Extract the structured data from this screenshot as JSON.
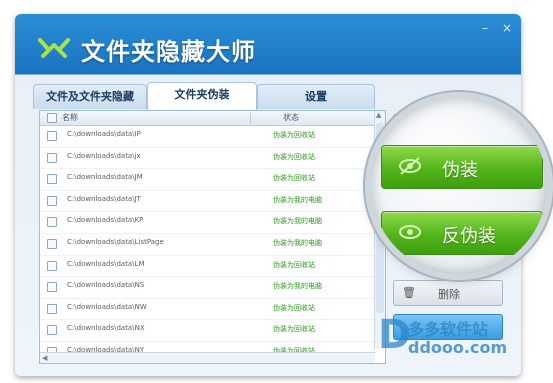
{
  "app": {
    "title": "文件夹隐藏大师"
  },
  "tabs": [
    {
      "label": "文件及文件夹隐藏"
    },
    {
      "label": "文件夹伪装"
    },
    {
      "label": "设置"
    }
  ],
  "list": {
    "columns": {
      "name": "名称",
      "status": "状态"
    },
    "rows": [
      {
        "path": "C:\\downloads\\data\\IP",
        "status": "伪装为回收站"
      },
      {
        "path": "C:\\downloads\\data\\jx",
        "status": "伪装为回收站"
      },
      {
        "path": "C:\\downloads\\data\\JM",
        "status": "伪装为回收站"
      },
      {
        "path": "C:\\downloads\\data\\JT",
        "status": "伪装为我的电脑"
      },
      {
        "path": "C:\\downloads\\data\\KP",
        "status": "伪装为我的电脑"
      },
      {
        "path": "C:\\downloads\\data\\ListPage",
        "status": "伪装为我的电脑"
      },
      {
        "path": "C:\\downloads\\data\\LM",
        "status": "伪装为回收站"
      },
      {
        "path": "C:\\downloads\\data\\NS",
        "status": "伪装为我的电脑"
      },
      {
        "path": "C:\\downloads\\data\\NW",
        "status": "伪装为回收站"
      },
      {
        "path": "C:\\downloads\\data\\NX",
        "status": "伪装为回收站"
      },
      {
        "path": "C:\\downloads\\data\\NY",
        "status": "伪装为回收站"
      }
    ]
  },
  "actions": {
    "disguise": "伪装",
    "undisguise": "反伪装",
    "delete": "删除"
  },
  "watermark": {
    "logo": "D",
    "site_name": "多多软件站",
    "domain": "ddooo.com"
  },
  "colors": {
    "title_bar": "#1a73c2",
    "action_green": "#52b51a",
    "status_text": "#2c9b1e"
  }
}
